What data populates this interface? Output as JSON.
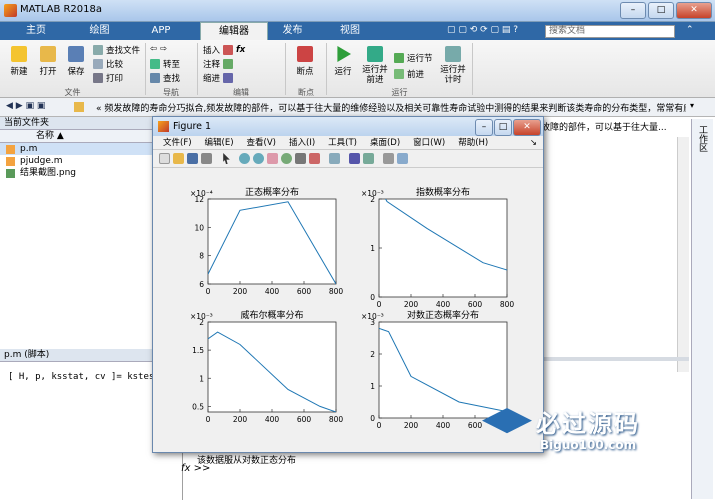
{
  "window": {
    "title": "MATLAB R2018a",
    "minimize": "–",
    "maximize": "□",
    "close": "✕"
  },
  "tabs": [
    "主页",
    "绘图",
    "APP",
    "编辑器",
    "发布",
    "视图"
  ],
  "search": {
    "placeholder": "搜索文档"
  },
  "ribbon": {
    "new": "新建",
    "open": "打开",
    "save": "保存",
    "find_files": "查找文件",
    "compare": "比较",
    "print": "打印",
    "file_group": "文件",
    "insert": "插入",
    "comment": "注释",
    "indent": "缩进",
    "fx": "fx",
    "goto": "转至",
    "find": "查找",
    "nav_group": "导航",
    "edit_group": "编辑",
    "breakpoints": "断点",
    "breakpoints_group": "断点",
    "run": "运行",
    "run_advance": "运行并\n前进",
    "run_section": "运行节",
    "advance": "前进",
    "run_time": "运行并\n计时",
    "run_group": "运行"
  },
  "address": {
    "path": "« 频发故障的寿命分巧拟合,频发故障的部件，可以基于往大量的维修经验以及相关可靠性寿命试验中测得的结果来判断该类寿命的分布类型，常常有威布尔..."
  },
  "current_folder": {
    "title": "当前文件夹",
    "col_name": "名称 ▲",
    "files": [
      {
        "name": "p.m"
      },
      {
        "name": "pjudge.m"
      },
      {
        "name": "结果截图.png"
      }
    ]
  },
  "details": {
    "title": "p.m  (脚本)",
    "code": "[ H, p, ksstat, cv ]= kstest(x ,cdf,alp"
  },
  "right_panel": {
    "tab_text": "故障的部件，可以基于往大量...",
    "side_label": "工作区"
  },
  "command": {
    "line": "该数据服从对数正态分布",
    "prompt": "fx >>"
  },
  "figure": {
    "title": "Figure 1",
    "menu": [
      "文件(F)",
      "编辑(E)",
      "查看(V)",
      "插入(I)",
      "工具(T)",
      "桌面(D)",
      "窗口(W)",
      "帮助(H)"
    ],
    "menu_arrow": "↘"
  },
  "chart_data": [
    {
      "type": "line",
      "title": "正态概率分布",
      "exponent_label": "×10⁻⁴",
      "x": [
        0,
        200,
        500,
        800
      ],
      "y": [
        6.7,
        11.2,
        11.8,
        6.0
      ],
      "xlim": [
        0,
        800
      ],
      "ylim": [
        6,
        12
      ],
      "xticks": [
        0,
        200,
        400,
        600,
        800
      ],
      "yticks": [
        6,
        8,
        10,
        12
      ]
    },
    {
      "type": "line",
      "title": "指数概率分布",
      "exponent_label": "×10⁻³",
      "x": [
        0,
        50,
        300,
        650,
        1000
      ],
      "y": [
        2.25,
        1.95,
        1.4,
        0.7,
        0.35
      ],
      "xlim": [
        0,
        800
      ],
      "ylim": [
        0,
        2
      ],
      "xticks": [
        0,
        200,
        400,
        600,
        800
      ],
      "yticks": [
        0,
        1,
        2
      ]
    },
    {
      "type": "line",
      "title": "威布尔概率分布",
      "exponent_label": "×10⁻³",
      "x": [
        0,
        60,
        200,
        500,
        700,
        800
      ],
      "y": [
        1.7,
        1.82,
        1.6,
        0.8,
        0.5,
        0.4
      ],
      "xlim": [
        0,
        800
      ],
      "ylim": [
        0.4,
        2
      ],
      "xticks": [
        0,
        200,
        400,
        600,
        800
      ],
      "yticks": [
        0.5,
        1,
        1.5,
        2
      ]
    },
    {
      "type": "line",
      "title": "对数正态概率分布",
      "exponent_label": "×10⁻³",
      "x": [
        0,
        60,
        200,
        500,
        800
      ],
      "y": [
        2.8,
        2.7,
        1.3,
        0.5,
        0.2
      ],
      "xlim": [
        0,
        800
      ],
      "ylim": [
        0,
        3
      ],
      "xticks": [
        0,
        200,
        400,
        600
      ],
      "yticks": [
        0,
        1,
        2,
        3
      ]
    }
  ],
  "watermark": {
    "text": "必过源码",
    "url": "Biguo100.com"
  },
  "colors": {
    "series": "#1f77b4",
    "tabbar": "#2f68a6"
  }
}
